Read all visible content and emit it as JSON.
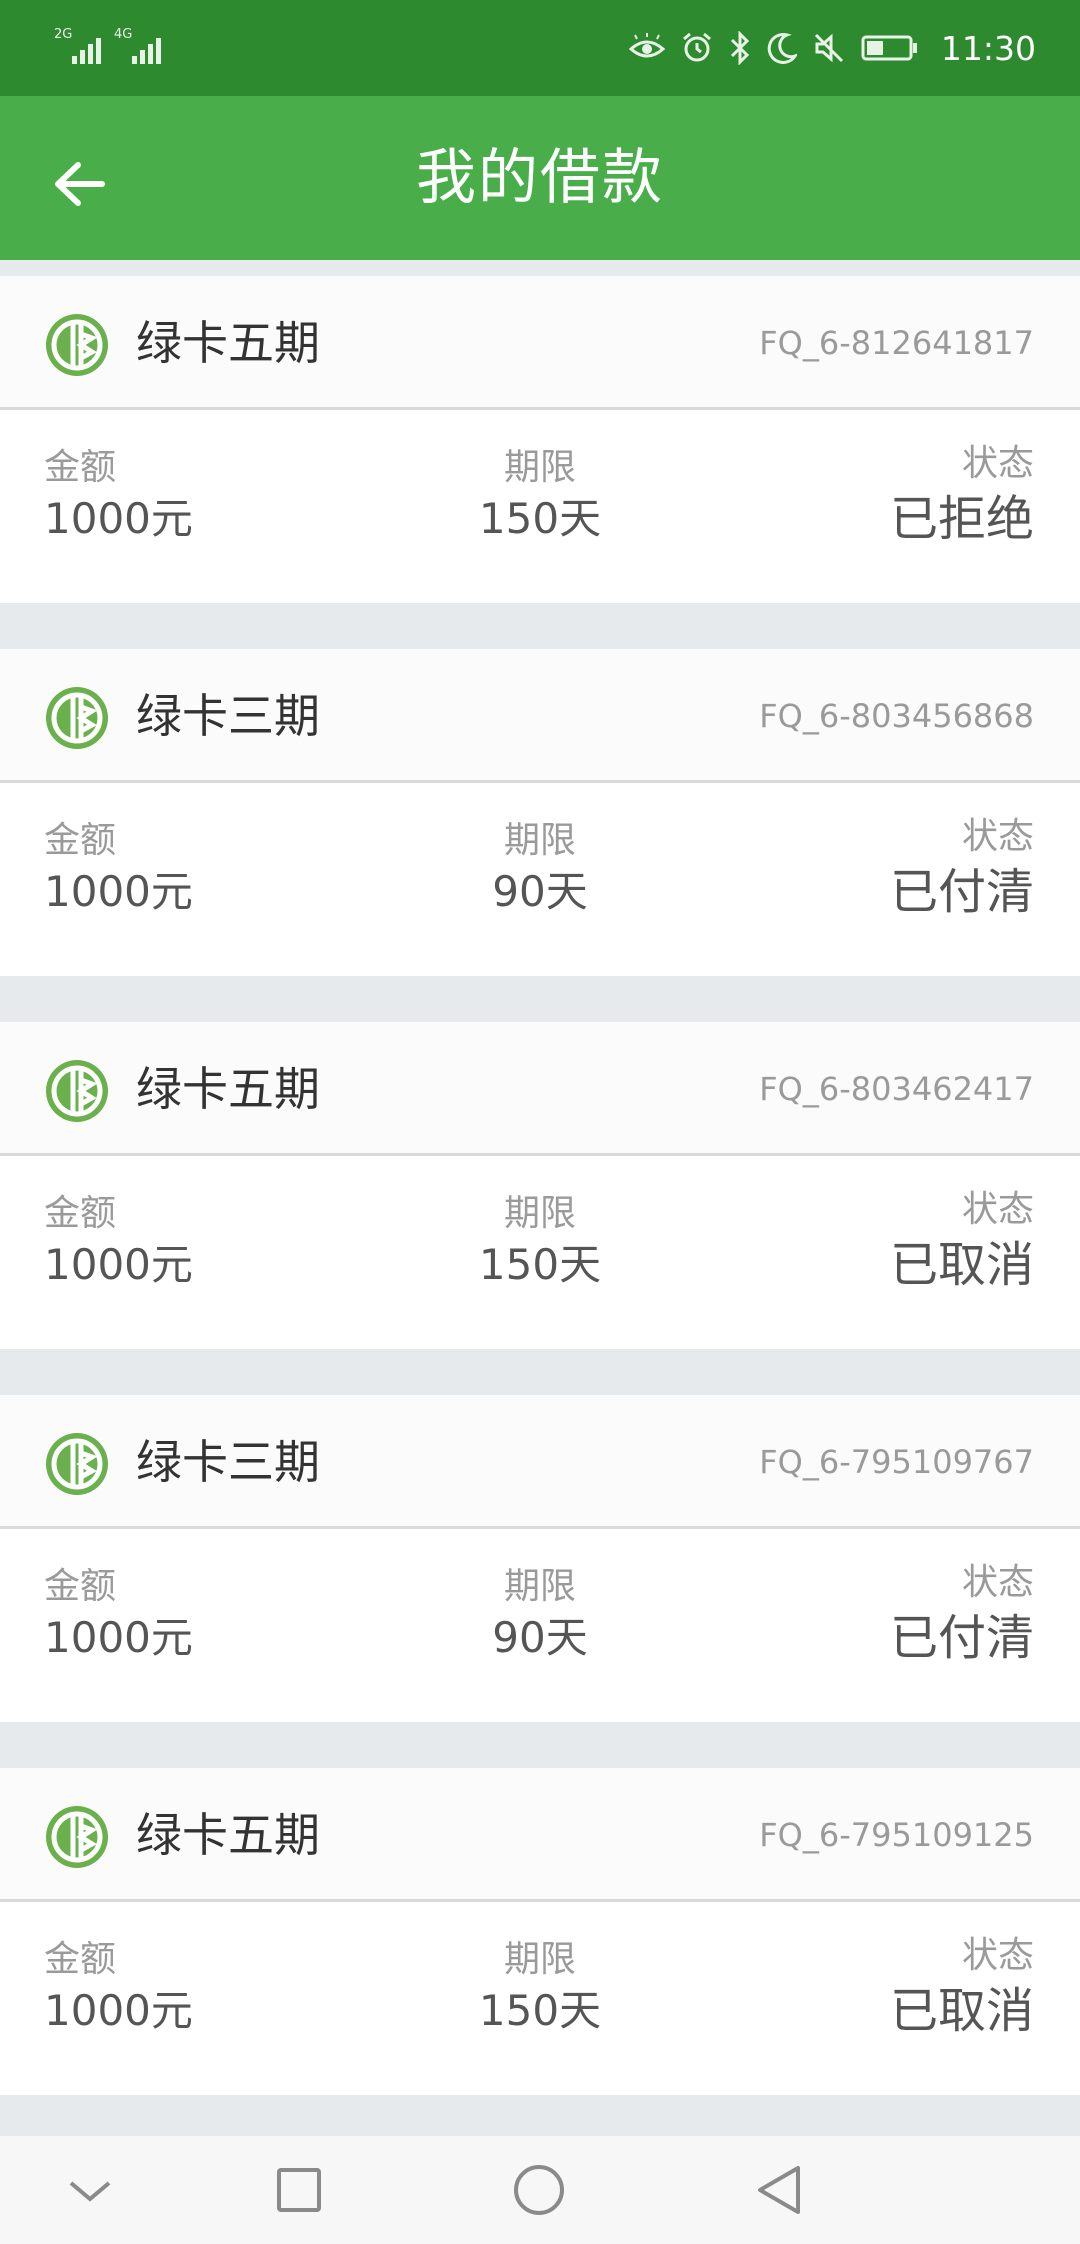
{
  "status_bar": {
    "network1": "2G",
    "network2": "4G",
    "time": "11:30",
    "icons": [
      "eye-icon",
      "alarm-icon",
      "bluetooth-icon",
      "moon-icon",
      "mute-icon",
      "battery-icon"
    ]
  },
  "header": {
    "title": "我的借款",
    "back_icon": "arrow-left-icon"
  },
  "labels": {
    "amount": "金额",
    "term": "期限",
    "status": "状态"
  },
  "loans": [
    {
      "product": "绿卡五期",
      "id": "FQ_6-812641817",
      "amount": "1000元",
      "term": "150天",
      "status": "已拒绝"
    },
    {
      "product": "绿卡三期",
      "id": "FQ_6-803456868",
      "amount": "1000元",
      "term": "90天",
      "status": "已付清"
    },
    {
      "product": "绿卡五期",
      "id": "FQ_6-803462417",
      "amount": "1000元",
      "term": "150天",
      "status": "已取消"
    },
    {
      "product": "绿卡三期",
      "id": "FQ_6-795109767",
      "amount": "1000元",
      "term": "90天",
      "status": "已付清"
    },
    {
      "product": "绿卡五期",
      "id": "FQ_6-795109125",
      "amount": "1000元",
      "term": "150天",
      "status": "已取消"
    }
  ],
  "nav": [
    "chevron-down-icon",
    "recent-apps-icon",
    "home-icon",
    "back-icon"
  ],
  "colors": {
    "status_bar": "#2e8a2e",
    "header": "#49ad49",
    "background": "#e7eaec",
    "logo": "#6ab04c"
  }
}
